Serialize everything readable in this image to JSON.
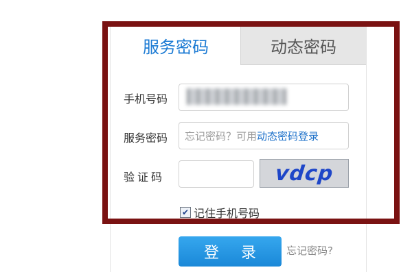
{
  "tabs": [
    {
      "label": "服务密码",
      "active": true
    },
    {
      "label": "动态密码",
      "active": false
    }
  ],
  "form": {
    "phone_label": "手机号码",
    "password_label": "服务密码",
    "password_hint": "忘记密码？可用",
    "password_hint_link": "动态密码登录",
    "captcha_label": "验证码",
    "captcha_value": "",
    "captcha_image_text": "vdcp",
    "remember_label": "记住手机号码",
    "remember_checked": true
  },
  "actions": {
    "login_label": "登录",
    "forgot_label": "忘记密码?"
  },
  "colors": {
    "accent": "#1c7bd4",
    "frame": "#7a1212",
    "button": "#1a88d8"
  }
}
